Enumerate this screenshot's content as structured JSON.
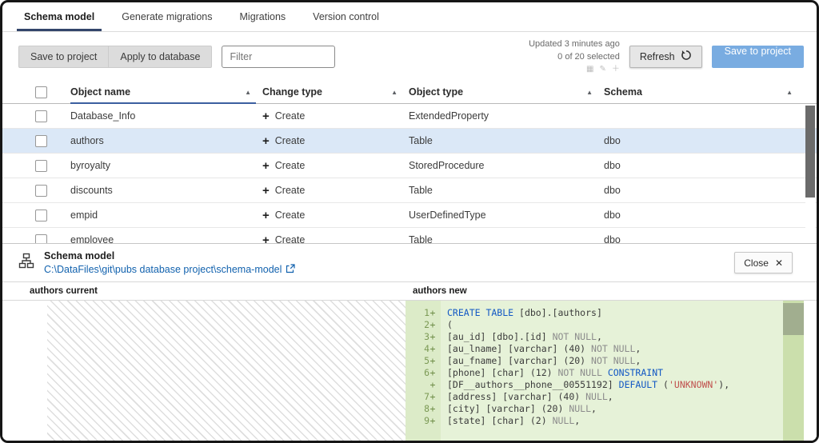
{
  "tabs": [
    {
      "label": "Schema model",
      "active": true
    },
    {
      "label": "Generate migrations",
      "active": false
    },
    {
      "label": "Migrations",
      "active": false
    },
    {
      "label": "Version control",
      "active": false
    }
  ],
  "toolbar": {
    "save_to_project": "Save to project",
    "apply_to_database": "Apply to database",
    "filter_placeholder": "Filter",
    "updated": "Updated 3 minutes ago",
    "selected_count": "0 of 20 selected",
    "refresh": "Refresh",
    "save_primary": "Save to project"
  },
  "icons": {
    "sort_asc": "▲",
    "close": "✕",
    "plus": "+",
    "grid": "▦",
    "edit": "✎",
    "add": "＋"
  },
  "colors": {
    "accent_button": "#79ACE1",
    "row_highlight": "#DBE8F7",
    "diff_added_bg": "#E6F2D8",
    "link": "#1262AE"
  },
  "table": {
    "headers": [
      "Object name",
      "Change type",
      "Object type",
      "Schema"
    ],
    "rows": [
      {
        "name": "Database_Info",
        "change": "Create",
        "type": "ExtendedProperty",
        "schema": "",
        "highlighted": false
      },
      {
        "name": "authors",
        "change": "Create",
        "type": "Table",
        "schema": "dbo",
        "highlighted": true
      },
      {
        "name": "byroyalty",
        "change": "Create",
        "type": "StoredProcedure",
        "schema": "dbo",
        "highlighted": false
      },
      {
        "name": "discounts",
        "change": "Create",
        "type": "Table",
        "schema": "dbo",
        "highlighted": false
      },
      {
        "name": "empid",
        "change": "Create",
        "type": "UserDefinedType",
        "schema": "dbo",
        "highlighted": false
      },
      {
        "name": "employee",
        "change": "Create",
        "type": "Table",
        "schema": "dbo",
        "highlighted": false
      }
    ]
  },
  "panel": {
    "title": "Schema model",
    "path": "C:\\DataFiles\\git\\pubs database project\\schema-model",
    "close_label": "Close"
  },
  "diff": {
    "left_title": "authors current",
    "right_title": "authors new",
    "lines": [
      {
        "num": "1",
        "tokens": [
          {
            "t": "CREATE TABLE",
            "c": "kw"
          },
          {
            "t": " [dbo].[authors]",
            "c": "pl"
          }
        ]
      },
      {
        "num": "2",
        "tokens": [
          {
            "t": "(",
            "c": "pl"
          }
        ]
      },
      {
        "num": "3",
        "tokens": [
          {
            "t": "[au_id] [dbo].[id] ",
            "c": "pl"
          },
          {
            "t": "NOT NULL",
            "c": "kw2"
          },
          {
            "t": ",",
            "c": "pl"
          }
        ]
      },
      {
        "num": "4",
        "tokens": [
          {
            "t": "[au_lname] [varchar] (40) ",
            "c": "pl"
          },
          {
            "t": "NOT NULL",
            "c": "kw2"
          },
          {
            "t": ",",
            "c": "pl"
          }
        ]
      },
      {
        "num": "5",
        "tokens": [
          {
            "t": "[au_fname] [varchar] (20) ",
            "c": "pl"
          },
          {
            "t": "NOT NULL",
            "c": "kw2"
          },
          {
            "t": ",",
            "c": "pl"
          }
        ]
      },
      {
        "num": "6",
        "tokens": [
          {
            "t": "[phone] [char] (12) ",
            "c": "pl"
          },
          {
            "t": "NOT NULL",
            "c": "kw2"
          },
          {
            "t": " ",
            "c": "pl"
          },
          {
            "t": "CONSTRAINT",
            "c": "kw"
          }
        ]
      },
      {
        "num": "",
        "tokens": [
          {
            "t": "[DF__authors__phone__00551192] ",
            "c": "pl"
          },
          {
            "t": "DEFAULT",
            "c": "kw"
          },
          {
            "t": " (",
            "c": "pl"
          },
          {
            "t": "'UNKNOWN'",
            "c": "str"
          },
          {
            "t": "),",
            "c": "pl"
          }
        ]
      },
      {
        "num": "7",
        "tokens": [
          {
            "t": "[address] [varchar] (40) ",
            "c": "pl"
          },
          {
            "t": "NULL",
            "c": "kw2"
          },
          {
            "t": ",",
            "c": "pl"
          }
        ]
      },
      {
        "num": "8",
        "tokens": [
          {
            "t": "[city] [varchar] (20) ",
            "c": "pl"
          },
          {
            "t": "NULL",
            "c": "kw2"
          },
          {
            "t": ",",
            "c": "pl"
          }
        ]
      },
      {
        "num": "9",
        "tokens": [
          {
            "t": "[state] [char] (2) ",
            "c": "pl"
          },
          {
            "t": "NULL",
            "c": "kw2"
          },
          {
            "t": ",",
            "c": "pl"
          }
        ]
      }
    ]
  }
}
